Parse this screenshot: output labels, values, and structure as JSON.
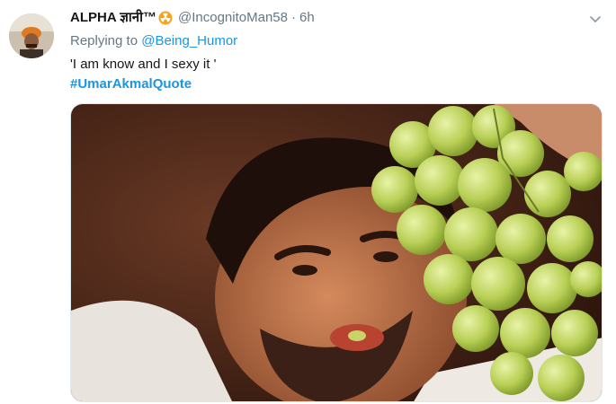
{
  "tweet": {
    "display_name": "ALPHA ज्ञानी™",
    "handle": "@IncognitoMan58",
    "separator": "·",
    "time": "6h",
    "replying_to_prefix": "Replying to ",
    "replying_to_user": "@Being_Humor",
    "text": "'I am know and I sexy it '",
    "hashtag": "#UmarAkmalQuote"
  },
  "icons": {
    "name_badge": "radioactive-emoji-icon",
    "menu": "chevron-down-icon"
  },
  "colors": {
    "link": "#1b95e0",
    "secondary_text": "#657786",
    "primary_text": "#14171a",
    "badge": "#f7a21b"
  }
}
